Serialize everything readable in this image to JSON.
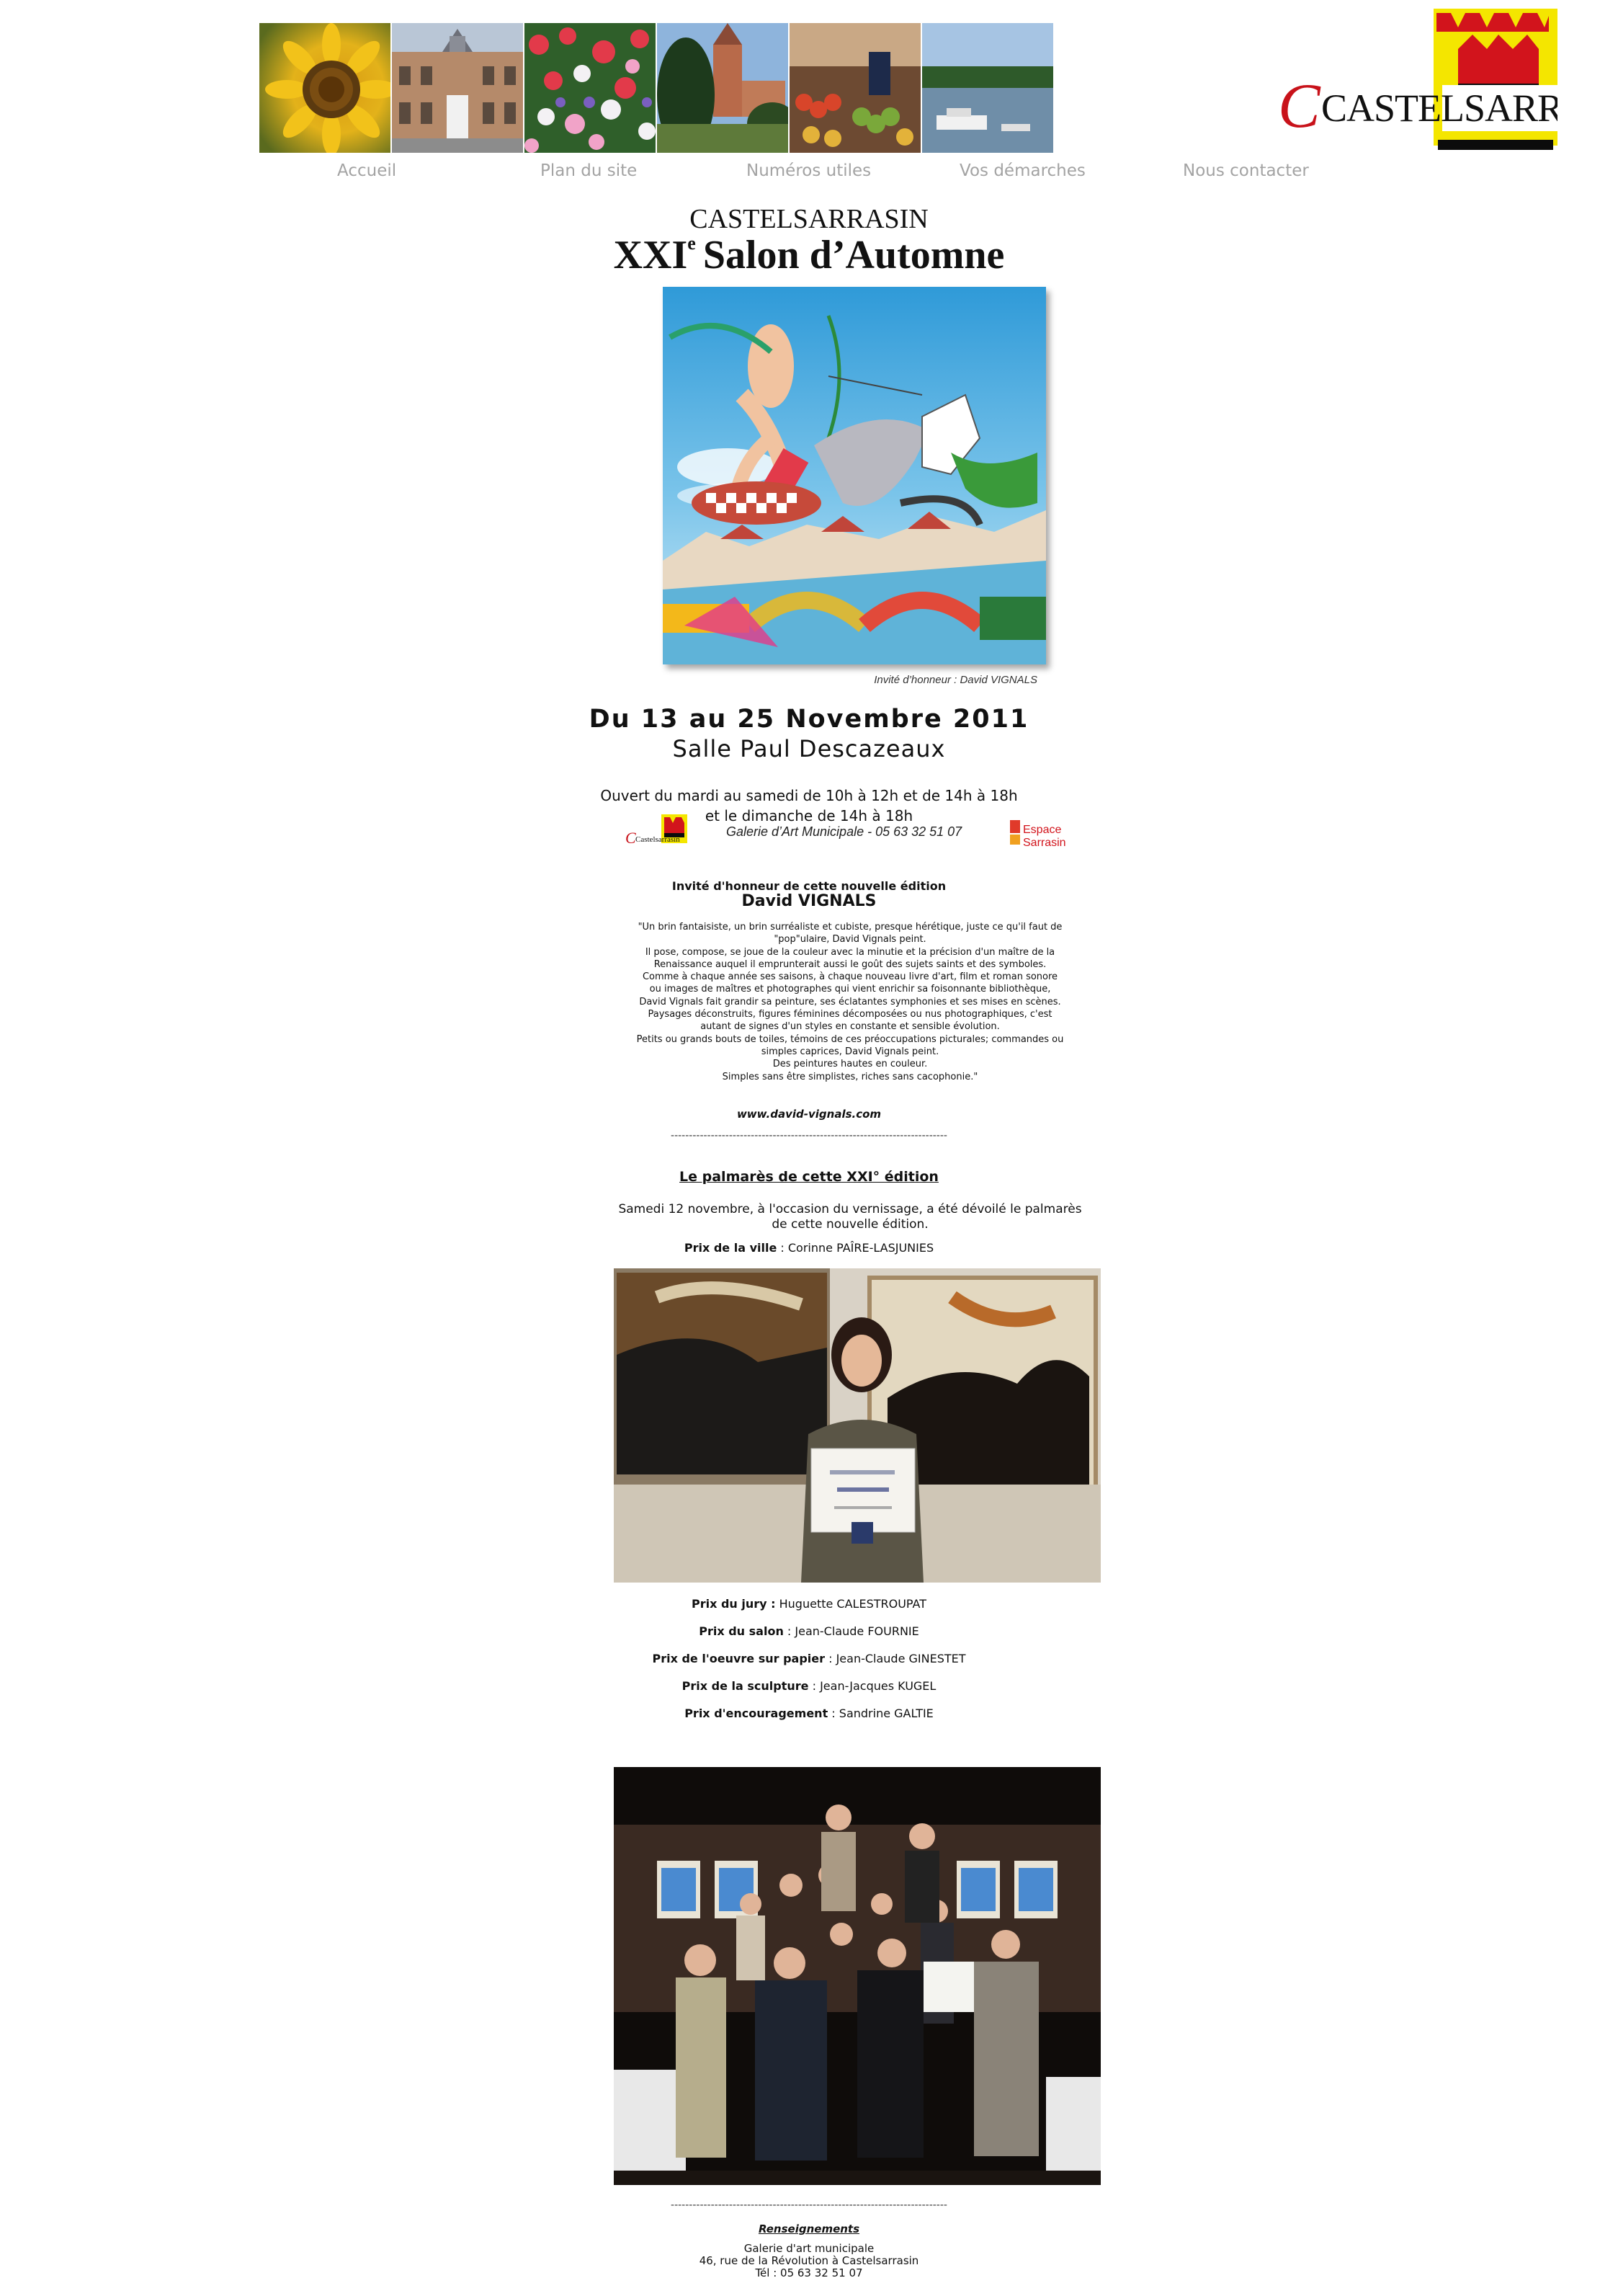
{
  "header": {
    "photos": [
      "sunflower",
      "town-hall",
      "flowers",
      "church",
      "market",
      "river"
    ],
    "logo_text": "CASTELSARRASIN",
    "nav": [
      {
        "label": "Accueil"
      },
      {
        "label": "Plan du site"
      },
      {
        "label": "Numéros utiles"
      },
      {
        "label": "Vos démarches"
      },
      {
        "label": "Nous contacter"
      }
    ]
  },
  "title": {
    "city": "CASTELSARRASIN",
    "numeral": "XXI",
    "suffix": "e",
    "name": "Salon d’Automne"
  },
  "poster": {
    "caption": "Invité d’honneur : David VIGNALS"
  },
  "event": {
    "dates": "Du 13 au 25 Novembre 2011",
    "hall": "Salle  Paul Descazeaux",
    "hours_1": "Ouvert du mardi au samedi de 10h à 12h et de 14h à 18h",
    "hours_2": "et le dimanche de 14h à 18h",
    "gallery": "Galerie d’Art Municipale - 05 63 32 51 07",
    "logo_left": "Castelsarrasin",
    "logo_right_1": "Espace",
    "logo_right_2": "Sarrasin"
  },
  "guest": {
    "heading": "Invité d'honneur de cette nouvelle édition",
    "name": "David VIGNALS",
    "bio": [
      "\"Un brin fantaisiste, un brin surréaliste et cubiste, presque hérétique, juste ce qu'il faut de",
      "\"pop\"ulaire, David Vignals peint.",
      "Il pose, compose, se joue de la couleur avec la minutie et la précision d'un maître de la",
      "Renaissance auquel il emprunterait aussi le goût des sujets saints et des symboles.",
      "Comme à chaque année ses saisons, à chaque nouveau livre d'art, film et roman sonore",
      "ou images de maîtres et photographes qui vient enrichir sa foisonnante bibliothèque,",
      "David Vignals fait grandir sa peinture, ses éclatantes symphonies et ses mises en scènes.",
      "Paysages déconstruits, figures féminines décomposées ou nus photographiques, c'est",
      "autant de signes d'un styles en constante et sensible évolution.",
      "Petits ou grands bouts de toiles, témoins de ces préoccupations picturales; commandes ou",
      "simples caprices, David Vignals peint.",
      "Des peintures hautes en couleur.",
      "Simples sans être simplistes, riches sans cacophonie.\""
    ],
    "website": "www.david-vignals.com"
  },
  "separator": "----------------------------------------------------------------------------",
  "palmares": {
    "heading": "Le palmarès de cette XXI° édition",
    "intro": "Samedi 12 novembre, à l'occasion du vernissage, a été dévoilé le palmarès de cette nouvelle édition.",
    "prizes": [
      {
        "label": "Prix de la ville",
        "winner": " : Corinne PAÎRE-LASJUNIES"
      },
      {
        "label": "Prix du jury :",
        "winner": " Huguette CALESTROUPAT"
      },
      {
        "label": "Prix du salon",
        "winner": " : Jean-Claude FOURNIE"
      },
      {
        "label": "Prix de l'oeuvre sur papier",
        "winner": " : Jean-Claude GINESTET"
      },
      {
        "label": "Prix de la sculpture",
        "winner": " : Jean-Jacques KUGEL"
      },
      {
        "label": "Prix d'encouragement",
        "winner": " : Sandrine GALTIE"
      }
    ]
  },
  "info": {
    "heading": "Renseignements",
    "line1": "Galerie d'art municipale",
    "line2": "46, rue de la Révolution à Castelsarrasin",
    "line3": "Tél : 05 63 32 51 07"
  }
}
